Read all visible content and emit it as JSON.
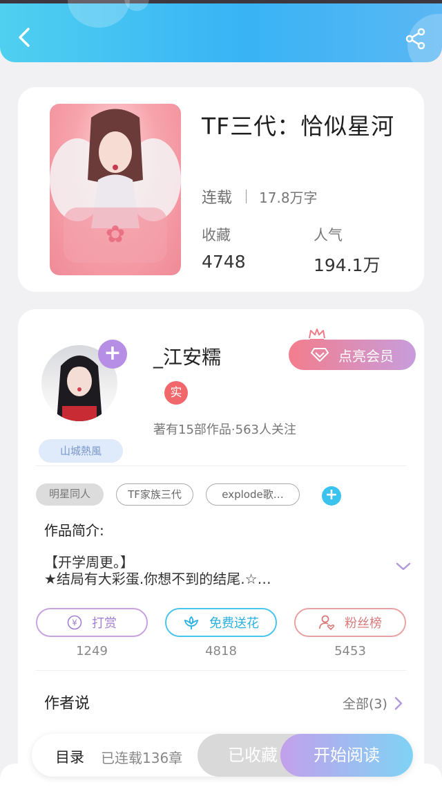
{
  "book": {
    "title": "TF三代：恰似星河",
    "status": "连载",
    "word_count": "17.8万字",
    "favorites_label": "收藏",
    "favorites_value": "4748",
    "popularity_label": "人气",
    "popularity_value": "194.1万"
  },
  "author": {
    "name": "_江安糯",
    "verified_badge": "实",
    "meta": "著有15部作品·563人关注",
    "nameplate": "山城熱風",
    "vip_button": "点亮会员"
  },
  "tags": [
    "明星同人",
    "TF家族三代",
    "explode歌…"
  ],
  "intro": {
    "label": "作品简介:",
    "lines": [
      "【开学周更。】",
      "★结局有大彩蛋.你想不到的结尾.☆…"
    ]
  },
  "actions": [
    {
      "label": "打赏",
      "count": "1249"
    },
    {
      "label": "免费送花",
      "count": "4818"
    },
    {
      "label": "粉丝榜",
      "count": "5453"
    }
  ],
  "author_says": {
    "label": "作者说",
    "all_link": "全部(3)"
  },
  "bottom": {
    "toc": "目录",
    "chapters": "已连载136章",
    "collected": "已收藏",
    "read": "开始阅读"
  },
  "colors": {
    "header_gradient_start": "#4fd0f0",
    "header_gradient_end": "#38b3f5",
    "accent_purple": "#b68ee6",
    "accent_blue": "#39c3ee",
    "verified_red": "#f0686b"
  }
}
